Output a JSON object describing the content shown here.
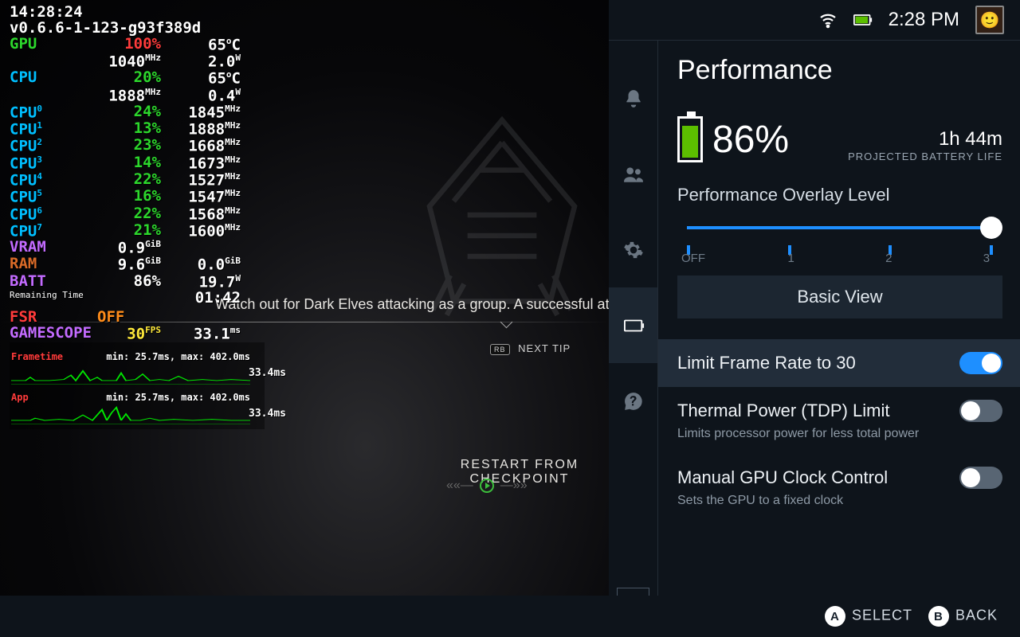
{
  "overlay": {
    "time": "14:28:24",
    "version": "v0.6.6-1-123-g93f389d",
    "gpu": {
      "label": "GPU",
      "load": "100%",
      "temp": "65",
      "clock": "1040",
      "clock_u": "MHz",
      "power": "2.0",
      "power_u": "W"
    },
    "cpu": {
      "label": "CPU",
      "load": "20%",
      "temp": "65",
      "clock": "1888",
      "clock_u": "MHz",
      "power": "0.4",
      "power_u": "W"
    },
    "cores": [
      {
        "label": "CPU",
        "idx": "0",
        "load": "24%",
        "clock": "1845"
      },
      {
        "label": "CPU",
        "idx": "1",
        "load": "13%",
        "clock": "1888"
      },
      {
        "label": "CPU",
        "idx": "2",
        "load": "23%",
        "clock": "1668"
      },
      {
        "label": "CPU",
        "idx": "3",
        "load": "14%",
        "clock": "1673"
      },
      {
        "label": "CPU",
        "idx": "4",
        "load": "22%",
        "clock": "1527"
      },
      {
        "label": "CPU",
        "idx": "5",
        "load": "16%",
        "clock": "1547"
      },
      {
        "label": "CPU",
        "idx": "6",
        "load": "22%",
        "clock": "1568"
      },
      {
        "label": "CPU",
        "idx": "7",
        "load": "21%",
        "clock": "1600"
      }
    ],
    "core_unit": "MHz",
    "vram": {
      "label": "VRAM",
      "val": "0.9",
      "unit": "GiB"
    },
    "ram": {
      "label": "RAM",
      "val": "9.6",
      "unit": "GiB",
      "val2": "0.0",
      "unit2": "GiB"
    },
    "batt": {
      "label": "BATT",
      "pct": "86%",
      "power": "19.7",
      "power_u": "W"
    },
    "remaining_label": "Remaining Time",
    "remaining_val": "01:42",
    "fsr": {
      "label": "FSR",
      "val": "OFF"
    },
    "gamescope": {
      "label": "GAMESCOPE",
      "fps": "30",
      "fps_u": "FPS",
      "ft": "33.1",
      "ft_u": "ms"
    },
    "frametime_label": "Frametime",
    "frametime_stats": "min: 25.7ms, max: 402.0ms",
    "frametime_cur": "33.4ms",
    "app_label": "App",
    "app_stats": "min: 25.7ms, max: 402.0ms",
    "app_cur": "33.4ms"
  },
  "game": {
    "tip": "Watch out for Dark Elves attacking as a group. A successful atta",
    "nexttip_btn": "RB",
    "nexttip": "NEXT TIP",
    "restart": "RESTART FROM CHECKPOINT"
  },
  "top": {
    "clock": "2:28 PM"
  },
  "panel": {
    "title": "Performance",
    "batt_pct": "86%",
    "batt_time": "1h 44m",
    "batt_proj": "PROJECTED BATTERY LIFE",
    "slider_label": "Performance Overlay Level",
    "slider_ticks": [
      "OFF",
      "1",
      "2",
      "3"
    ],
    "basic": "Basic View",
    "opt_frame": {
      "label": "Limit Frame Rate to 30",
      "on": true
    },
    "opt_tdp": {
      "label": "Thermal Power (TDP) Limit",
      "desc": "Limits processor power for less total power",
      "on": false
    },
    "opt_gpu": {
      "label": "Manual GPU Clock Control",
      "desc": "Sets the GPU to a fixed clock",
      "on": false
    }
  },
  "hints": {
    "a": "A",
    "select": "SELECT",
    "b": "B",
    "back": "BACK"
  }
}
